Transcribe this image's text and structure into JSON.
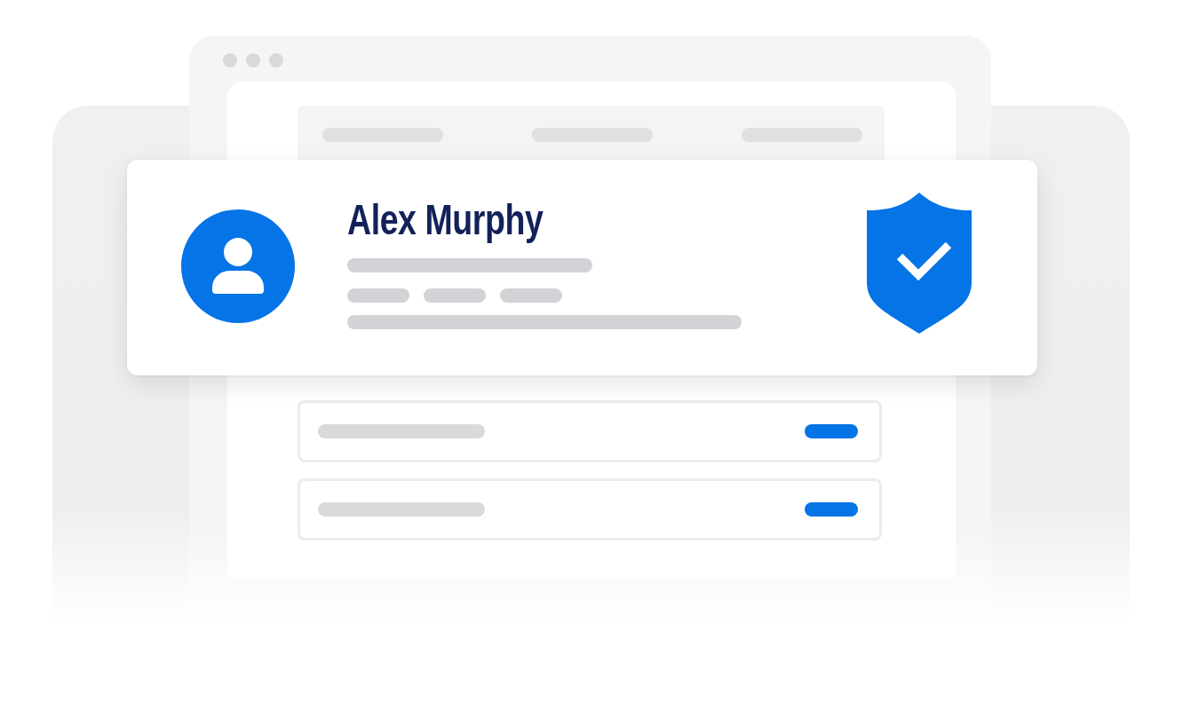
{
  "profile_card": {
    "name": "Alex Murphy",
    "verified": true
  }
}
